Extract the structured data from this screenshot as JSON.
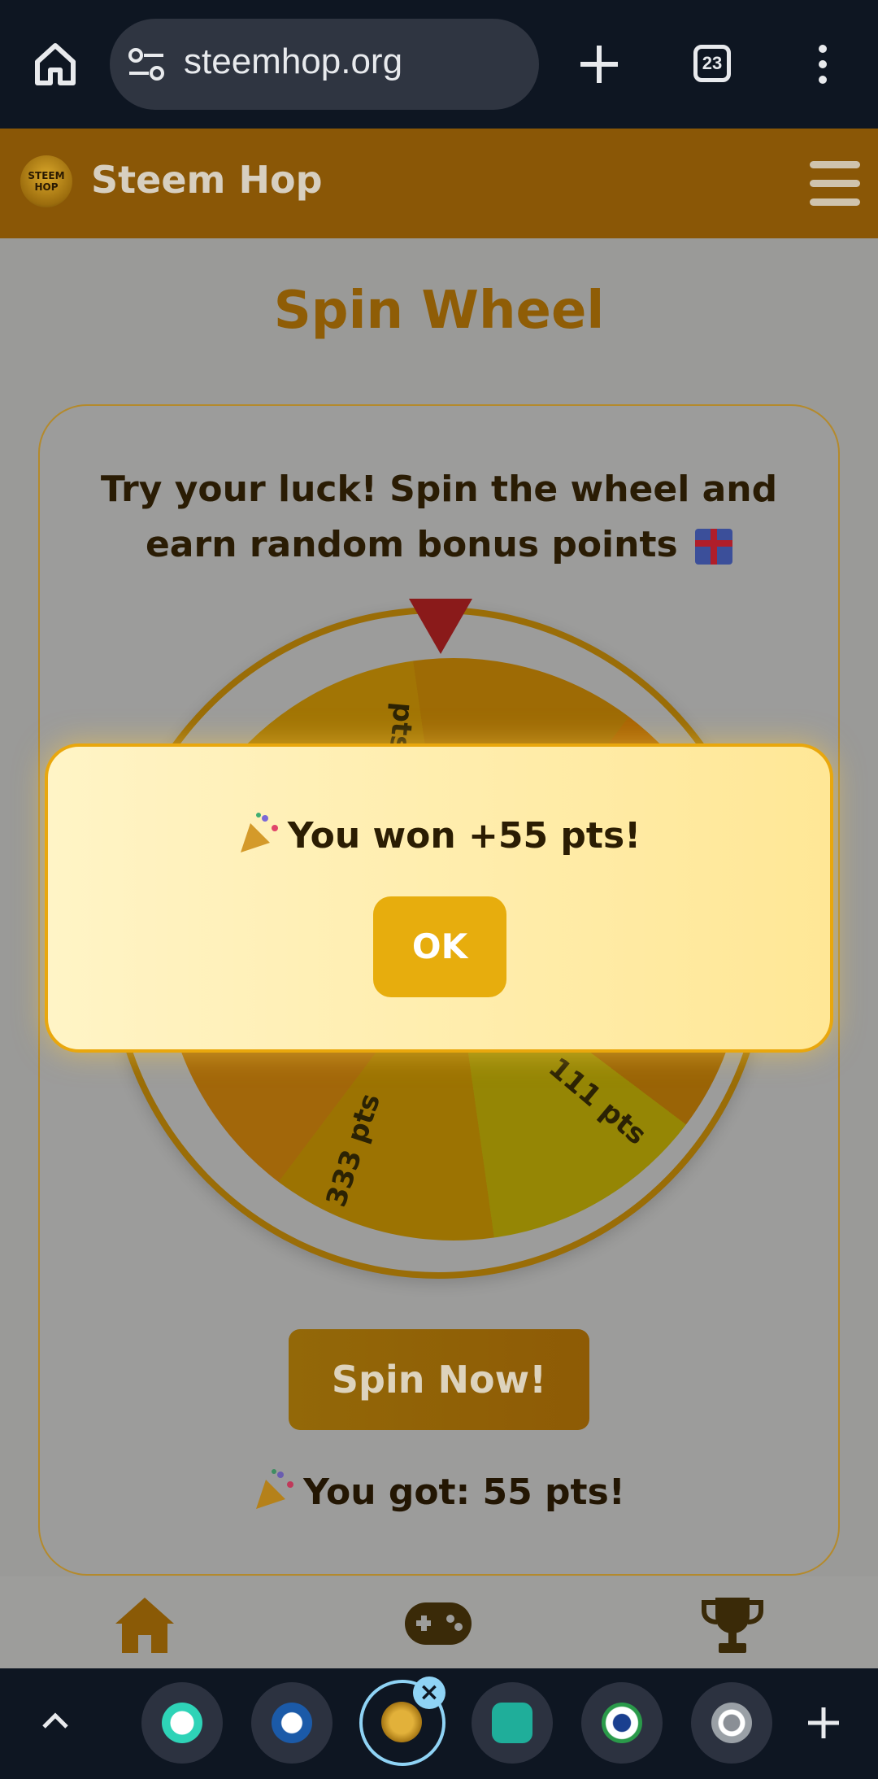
{
  "browser": {
    "url": "steemhop.org",
    "tab_count": "23"
  },
  "site": {
    "logo_text": "STEEM HOP",
    "title": "Steem Hop"
  },
  "page": {
    "title": "Spin Wheel",
    "intro": "Try your luck! Spin the wheel and earn random bonus points"
  },
  "wheel": {
    "segments": [
      "pts",
      "333 pts",
      "111 pts"
    ]
  },
  "spin_button_label": "Spin Now!",
  "result_text": "You got: 55 pts!",
  "modal": {
    "message": "You won +55 pts!",
    "ok_label": "OK"
  },
  "bottom_nav": {
    "items": [
      "home-icon",
      "gamepad-icon",
      "trophy-icon"
    ]
  },
  "dock": {
    "apps": [
      "chat-app-icon",
      "whale-app-icon",
      "steemhop-app-icon",
      "d4-app-icon",
      "steem-app-icon",
      "chrome-icon"
    ]
  },
  "colors": {
    "header_bg": "#8a5706",
    "accent": "#e7ad0d",
    "modal_bg": "#fff4c6"
  }
}
